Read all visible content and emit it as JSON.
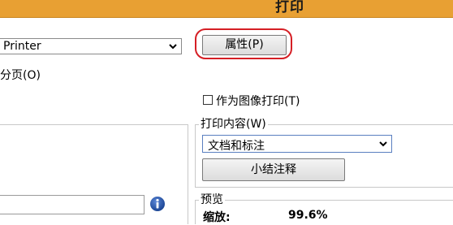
{
  "window": {
    "title": "打印"
  },
  "printer": {
    "selected": "Printer"
  },
  "buttons": {
    "properties": "属性(P)",
    "summarize_comments": "小结注释"
  },
  "collate": {
    "label": "分页(O)"
  },
  "print_as_image": {
    "label": "作为图像打印(T)",
    "checked": false
  },
  "print_content": {
    "legend": "打印内容(W)",
    "selected": "文档和标注"
  },
  "preview": {
    "legend": "预览",
    "zoom_label": "缩放:",
    "zoom_value": "99.6%"
  },
  "colors": {
    "titlebar": "#e8a033",
    "highlight": "#d51f25",
    "info": "#1f4e9c"
  },
  "icons": {
    "dropdown": "chevron-down-icon",
    "info": "info-icon"
  }
}
